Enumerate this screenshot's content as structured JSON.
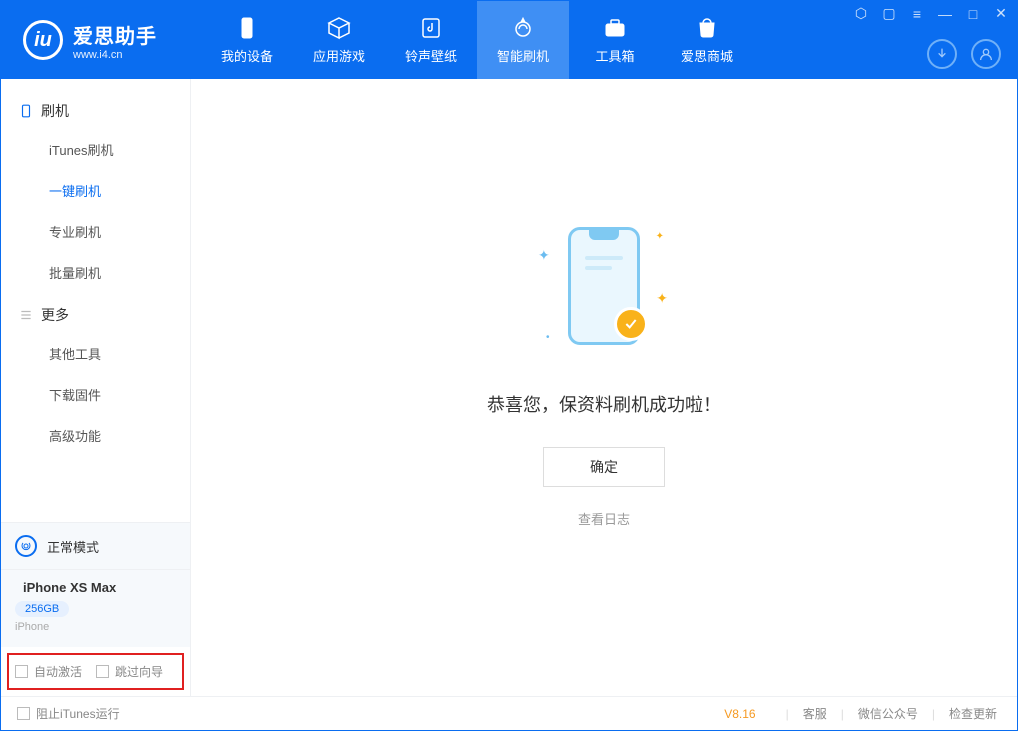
{
  "app": {
    "logo_title": "爱思助手",
    "logo_sub": "www.i4.cn"
  },
  "nav": {
    "items": [
      {
        "label": "我的设备",
        "icon": "device"
      },
      {
        "label": "应用游戏",
        "icon": "cube"
      },
      {
        "label": "铃声壁纸",
        "icon": "music"
      },
      {
        "label": "智能刷机",
        "icon": "refresh",
        "active": true
      },
      {
        "label": "工具箱",
        "icon": "toolbox"
      },
      {
        "label": "爱思商城",
        "icon": "shop"
      }
    ]
  },
  "sidebar": {
    "group1_title": "刷机",
    "group1_items": [
      "iTunes刷机",
      "一键刷机",
      "专业刷机",
      "批量刷机"
    ],
    "group1_active_index": 1,
    "group2_title": "更多",
    "group2_items": [
      "其他工具",
      "下载固件",
      "高级功能"
    ],
    "mode_label": "正常模式",
    "device_name": "iPhone XS Max",
    "device_storage": "256GB",
    "device_type": "iPhone",
    "checkbox_auto_activate": "自动激活",
    "checkbox_skip_guide": "跳过向导"
  },
  "main": {
    "success_text": "恭喜您，保资料刷机成功啦！",
    "ok_button": "确定",
    "view_log": "查看日志"
  },
  "footer": {
    "block_itunes": "阻止iTunes运行",
    "version": "V8.16",
    "link_support": "客服",
    "link_wechat": "微信公众号",
    "link_update": "检查更新"
  }
}
